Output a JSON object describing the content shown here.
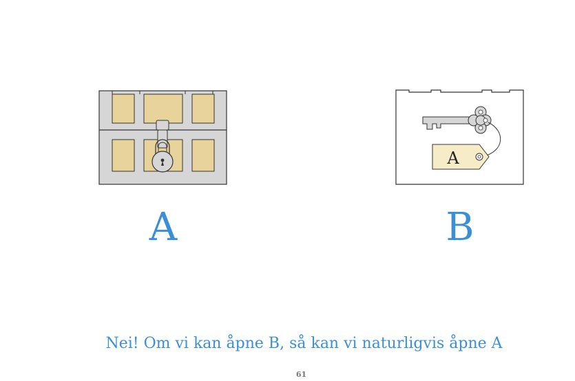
{
  "illustrations": {
    "chest": {
      "label": "A",
      "icon": "locked-chest-icon"
    },
    "box": {
      "label": "B",
      "icon": "box-with-key-icon",
      "key_tag_text": "A"
    }
  },
  "caption": "Nei! Om vi kan åpne B, så kan vi naturligvis åpne A",
  "page_number": "61",
  "colors": {
    "accent_blue": "#3b8fd6",
    "chest_gray": "#d6d6d6",
    "chest_panel": "#e8d49b",
    "tag_fill": "#f7ecc8"
  }
}
